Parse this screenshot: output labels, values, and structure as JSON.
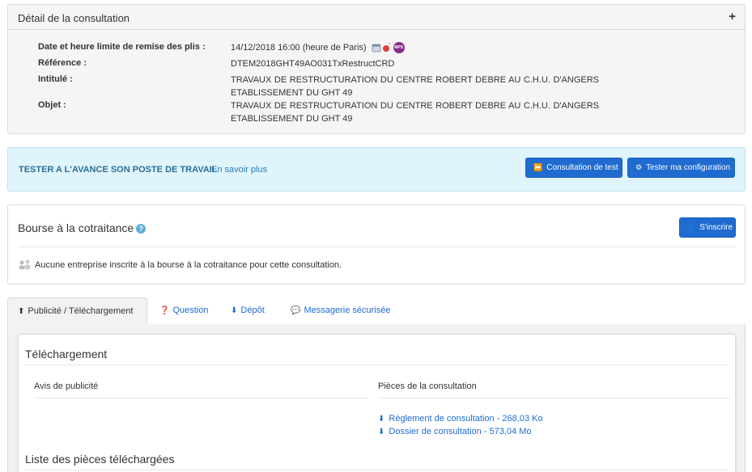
{
  "detail": {
    "header_title": "Détail de la consultation",
    "toggle_symbol": "+",
    "rows": [
      {
        "label": "Date et heure limite de remise des plis :",
        "value": "14/12/2018 16:00 (heure de Paris)"
      },
      {
        "label": "Référence :",
        "value": "DTEM2018GHT49AO031TxRestructCRD"
      },
      {
        "label": "Intitulé :",
        "value": "TRAVAUX DE RESTRUCTURATION DU CENTRE ROBERT DEBRE AU C.H.U. D'ANGERS ETABLISSEMENT DU GHT 49"
      },
      {
        "label": "Objet :",
        "value": "TRAVAUX DE RESTRUCTURATION DU CENTRE ROBERT DEBRE AU C.H.U. D'ANGERS ETABLISSEMENT DU GHT 49"
      }
    ],
    "mps_badge": "MPS"
  },
  "test_banner": {
    "title": "TESTER A L'AVANCE SON POSTE DE TRAVAIL",
    "link": "En savoir plus",
    "btn_consultation_test": "Consultation de test",
    "btn_tester_config": "Tester ma configuration"
  },
  "bourse": {
    "title": "Bourse à la cotraitance",
    "help_symbol": "?",
    "btn_inscrire": "S'inscrire",
    "empty_message": "Aucune entreprise inscrite à la bourse à la cotraitance pour cette consultation."
  },
  "tabs": [
    {
      "label": "Publicité / Téléchargement",
      "icon": "upload-icon"
    },
    {
      "label": "Question",
      "icon": "question-circle-icon"
    },
    {
      "label": "Dépôt",
      "icon": "download-icon"
    },
    {
      "label": "Messagerie sécurisée",
      "icon": "comments-icon"
    }
  ],
  "telechargement": {
    "title": "Téléchargement",
    "col_avis": "Avis de publicité",
    "col_pieces": "Pièces de la consultation",
    "files": [
      {
        "label": "Règlement de consultation - 268,03 Ko"
      },
      {
        "label": "Dossier de consultation - 573,04 Mo"
      }
    ],
    "list_title": "Liste des pièces téléchargées"
  },
  "colors": {
    "primary_button": "#1f6bd0",
    "link": "#1f6bd0",
    "banner_bg": "#e0f4fb",
    "banner_title": "#2a6f97",
    "mps_purple": "#8a2b8c"
  }
}
